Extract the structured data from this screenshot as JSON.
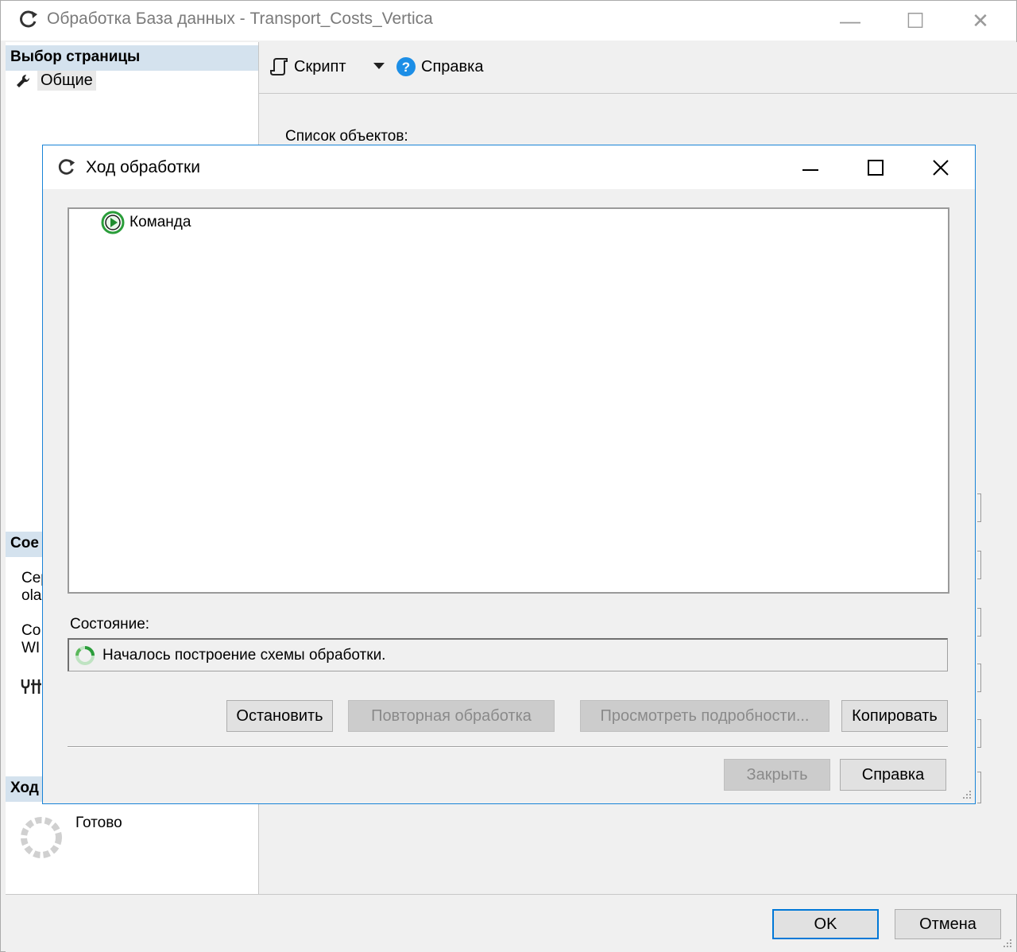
{
  "main_window": {
    "title": "Обработка База данных - Transport_Costs_Vertica",
    "min_glyph": "—",
    "max_glyph": "☐",
    "close_glyph": "✕"
  },
  "left_pane": {
    "select_page_header": "Выбор страницы",
    "pages": [
      {
        "label": "Общие",
        "icon": "wrench-icon"
      }
    ],
    "connection_header": "Сое",
    "server_label": "Сер",
    "server_value": "ola",
    "connection_label": "Со",
    "connection_value": "WI",
    "progress_header": "Ход",
    "progress_status": "Готово"
  },
  "toolbar": {
    "script_label": "Скрипт",
    "help_label": "Справка"
  },
  "content": {
    "object_list_label": "Список объектов:"
  },
  "dialog": {
    "title": "Ход обработки",
    "tree_items": [
      {
        "label": "Команда",
        "icon": "play-circle-icon"
      }
    ],
    "status_label": "Состояние:",
    "status_text": "Началось построение схемы обработки.",
    "buttons": {
      "stop": "Остановить",
      "reprocess": "Повторная обработка",
      "view_details": "Просмотреть подробности...",
      "copy": "Копировать",
      "close": "Закрыть",
      "help": "Справка"
    }
  },
  "footer": {
    "ok": "OK",
    "cancel": "Отмена"
  },
  "colors": {
    "accent": "#0078d7",
    "section_header_bg": "#d4e2ee",
    "help_icon": "#1c8ee6",
    "play_icon": "#2a9d3a"
  }
}
